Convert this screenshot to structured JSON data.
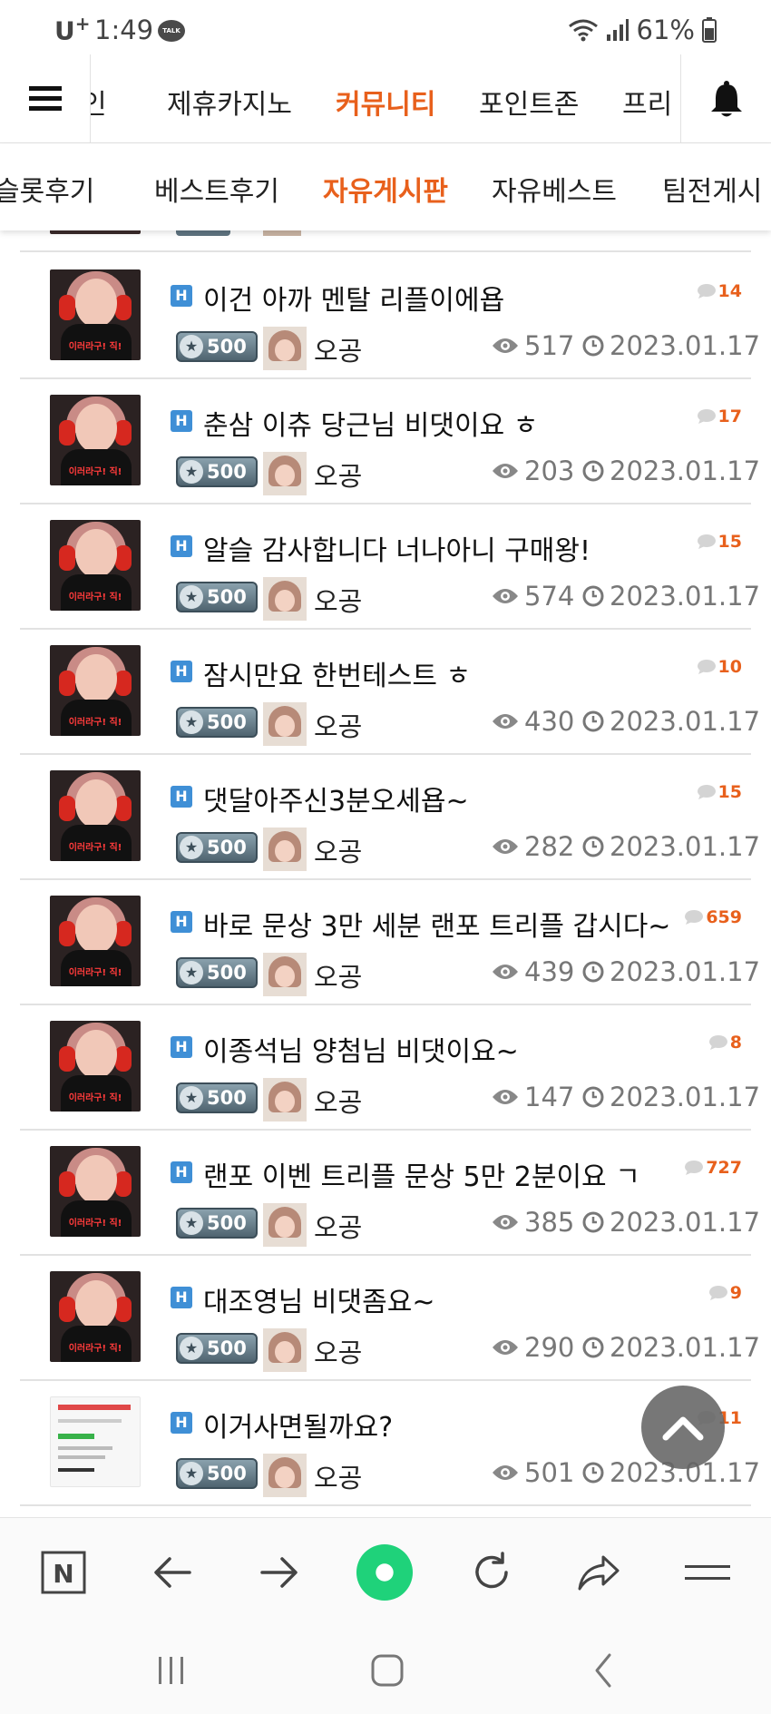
{
  "status_bar": {
    "carrier": "U",
    "carrier_sup": "+",
    "time": "1:49",
    "talk_label": "TALK",
    "battery": "61%"
  },
  "top_nav": {
    "items": [
      {
        "label": "인"
      },
      {
        "label": "제휴카지노"
      },
      {
        "label": "커뮤니티"
      },
      {
        "label": "포인트존"
      },
      {
        "label": "프리"
      }
    ],
    "active_index": 2
  },
  "sub_nav": {
    "items": [
      {
        "label": "슬롯후기"
      },
      {
        "label": "베스트후기"
      },
      {
        "label": "자유게시판"
      },
      {
        "label": "자유베스트"
      },
      {
        "label": "팀전게시"
      }
    ],
    "active_index": 2
  },
  "posts": [
    {
      "title": "이건 아까 멘탈 리플이에욥",
      "comments": "14",
      "badge": "500",
      "author": "오공",
      "views": "517",
      "date": "2023.01.17",
      "thumb": "photo",
      "thumb_caption": "이러라구! 직!"
    },
    {
      "title": "춘삼 이츄 당근님 비댓이요 ㅎ",
      "comments": "17",
      "badge": "500",
      "author": "오공",
      "views": "203",
      "date": "2023.01.17",
      "thumb": "photo",
      "thumb_caption": "이러라구! 직!"
    },
    {
      "title": "알슬 감사합니다 너나아니 구매왕!",
      "comments": "15",
      "badge": "500",
      "author": "오공",
      "views": "574",
      "date": "2023.01.17",
      "thumb": "photo",
      "thumb_caption": "이러라구! 직!"
    },
    {
      "title": "잠시만요 한번테스트 ㅎ",
      "comments": "10",
      "badge": "500",
      "author": "오공",
      "views": "430",
      "date": "2023.01.17",
      "thumb": "photo",
      "thumb_caption": "이러라구! 직!"
    },
    {
      "title": "댓달아주신3분오세욥~",
      "comments": "15",
      "badge": "500",
      "author": "오공",
      "views": "282",
      "date": "2023.01.17",
      "thumb": "photo",
      "thumb_caption": "이러라구! 직!"
    },
    {
      "title": "바로 문상 3만 세분 랜포 트리플 갑시다~",
      "comments": "659",
      "badge": "500",
      "author": "오공",
      "views": "439",
      "date": "2023.01.17",
      "thumb": "photo",
      "thumb_caption": "이러라구! 직!"
    },
    {
      "title": "이종석님 양첨님 비댓이요~",
      "comments": "8",
      "badge": "500",
      "author": "오공",
      "views": "147",
      "date": "2023.01.17",
      "thumb": "photo",
      "thumb_caption": "이러라구! 직!"
    },
    {
      "title": "랜포 이벤 트리플 문상 5만 2분이요 ㄱ",
      "comments": "727",
      "badge": "500",
      "author": "오공",
      "views": "385",
      "date": "2023.01.17",
      "thumb": "photo",
      "thumb_caption": "이러라구! 직!"
    },
    {
      "title": "대조영님 비댓좀요~",
      "comments": "9",
      "badge": "500",
      "author": "오공",
      "views": "290",
      "date": "2023.01.17",
      "thumb": "photo",
      "thumb_caption": "이러라구! 직!"
    },
    {
      "title": "이거사면될까요?",
      "comments": "11",
      "badge": "500",
      "author": "오공",
      "views": "501",
      "date": "2023.01.17",
      "thumb": "doc",
      "thumb_caption": ""
    }
  ],
  "post_hot_mark": "H",
  "colors": {
    "accent": "#e8601c",
    "hot_icon": "#3f8fd6",
    "meta_text": "#777777",
    "divider": "#e2e2e2",
    "browser_green": "#1fd27a"
  },
  "bottom_bar": {
    "icons": [
      "naver-n-icon",
      "back-arrow-icon",
      "forward-arrow-icon",
      "green-dot-icon",
      "reload-icon",
      "share-icon",
      "menu-icon"
    ],
    "naver_label": "N"
  },
  "system_nav": {
    "icons": [
      "recent-apps-icon",
      "home-icon",
      "back-icon"
    ]
  }
}
